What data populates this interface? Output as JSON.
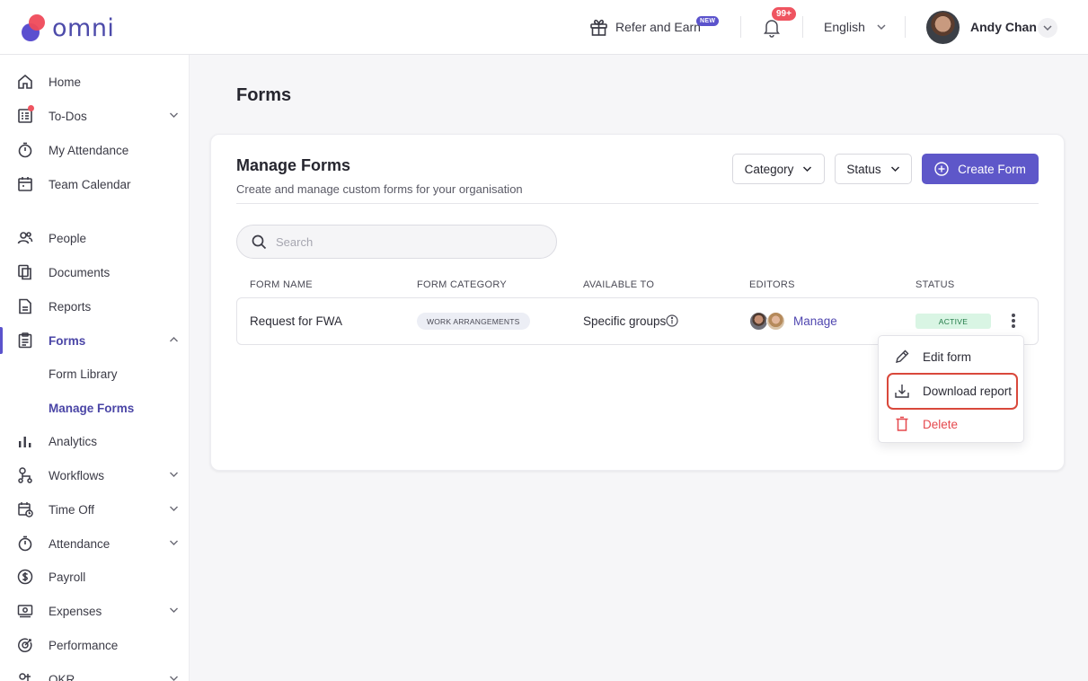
{
  "app": {
    "logo_text": "omni"
  },
  "header": {
    "refer_label": "Refer and Earn",
    "refer_badge": "NEW",
    "notification_count": "99+",
    "language": "English",
    "user_name": "Andy Chan"
  },
  "sidebar": {
    "items": [
      {
        "label": "Home",
        "icon": "home-icon"
      },
      {
        "label": "To-Dos",
        "icon": "todo-list-icon"
      },
      {
        "label": "My Attendance",
        "icon": "stopwatch-icon"
      },
      {
        "label": "Team Calendar",
        "icon": "calendar-icon"
      },
      {
        "label": "People",
        "icon": "people-icon"
      },
      {
        "label": "Documents",
        "icon": "documents-icon"
      },
      {
        "label": "Reports",
        "icon": "report-icon"
      },
      {
        "label": "Forms",
        "icon": "form-icon"
      },
      {
        "label": "Analytics",
        "icon": "bar-chart-icon"
      },
      {
        "label": "Workflows",
        "icon": "workflow-icon"
      },
      {
        "label": "Time Off",
        "icon": "time-off-icon"
      },
      {
        "label": "Attendance",
        "icon": "stopwatch-icon"
      },
      {
        "label": "Payroll",
        "icon": "dollar-icon"
      },
      {
        "label": "Expenses",
        "icon": "money-icon"
      },
      {
        "label": "Performance",
        "icon": "target-icon"
      },
      {
        "label": "OKR",
        "icon": "okr-icon"
      }
    ],
    "forms_sub": [
      {
        "label": "Form Library"
      },
      {
        "label": "Manage Forms"
      }
    ]
  },
  "main": {
    "page_title": "Forms",
    "card_title": "Manage Forms",
    "card_subtitle": "Create and manage custom forms for your organisation",
    "category_filter": "Category",
    "status_filter": "Status",
    "create_button": "Create Form",
    "search_placeholder": "Search",
    "table": {
      "headers": [
        "FORM NAME",
        "FORM CATEGORY",
        "AVAILABLE TO",
        "EDITORS",
        "STATUS"
      ],
      "rows": [
        {
          "name": "Request for FWA",
          "category": "WORK ARRANGEMENTS",
          "available_to": "Specific groups",
          "editors_link": "Manage",
          "status": "ACTIVE"
        }
      ]
    },
    "row_menu": {
      "items": [
        {
          "label": "Edit form",
          "icon": "pencil-icon"
        },
        {
          "label": "Download report",
          "icon": "download-icon"
        },
        {
          "label": "Delete",
          "icon": "trash-icon"
        }
      ]
    }
  },
  "colors": {
    "primary": "#5e57c9",
    "danger": "#e5484d",
    "active_bg": "#d9f5e4",
    "highlight": "#d9483b"
  }
}
